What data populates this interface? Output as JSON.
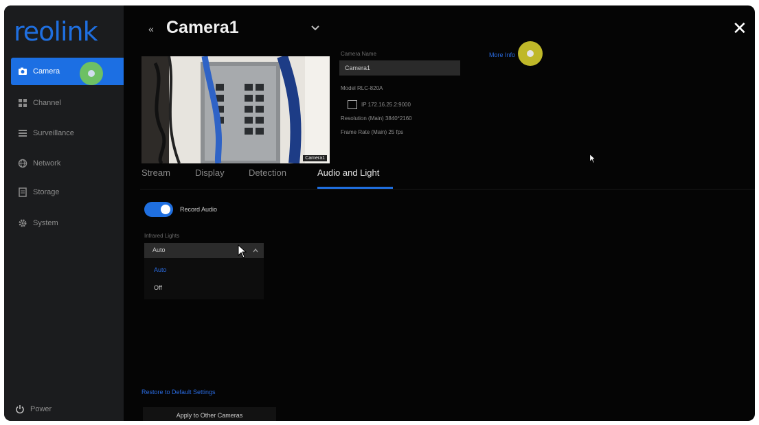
{
  "sidebar": {
    "logo": "reolink",
    "items": [
      {
        "label": "Camera",
        "icon": "camera-icon"
      },
      {
        "label": "Channel",
        "icon": "channel-icon"
      },
      {
        "label": "Surveillance",
        "icon": "surveillance-icon"
      },
      {
        "label": "Network",
        "icon": "network-icon"
      },
      {
        "label": "Storage",
        "icon": "storage-icon"
      },
      {
        "label": "System",
        "icon": "gear-icon"
      }
    ],
    "power_label": "Power"
  },
  "header": {
    "back_glyph": "«",
    "title": "Camera1",
    "close_glyph": "✕"
  },
  "camera_info": {
    "name_label": "Camera Name",
    "name_value": "Camera1",
    "model_text": "Model   RLC-820A",
    "ip_text": "IP   172.16.25.2:9000",
    "main_stream_text": "Resolution (Main)   3840*2160",
    "sub_stream_text": "Frame Rate (Main)   25 fps",
    "more_link": "More Info",
    "preview_badge": "Camera1"
  },
  "tabs": [
    {
      "label": "Stream",
      "active": false
    },
    {
      "label": "Display",
      "active": false
    },
    {
      "label": "Detection",
      "active": false
    },
    {
      "label": "Audio and Light",
      "active": true
    }
  ],
  "audio_light": {
    "record_audio_label": "Record Audio",
    "record_audio_on": true,
    "ir_label": "Infrared Lights",
    "ir_value": "Auto",
    "ir_options": [
      "Auto",
      "Off"
    ]
  },
  "footer": {
    "restore_link": "Restore to Default Settings",
    "apply_button": "Apply to Other Cameras"
  },
  "colors": {
    "accent": "#1f6fe0",
    "background": "#050505",
    "sidebar": "#1b1c1e"
  }
}
